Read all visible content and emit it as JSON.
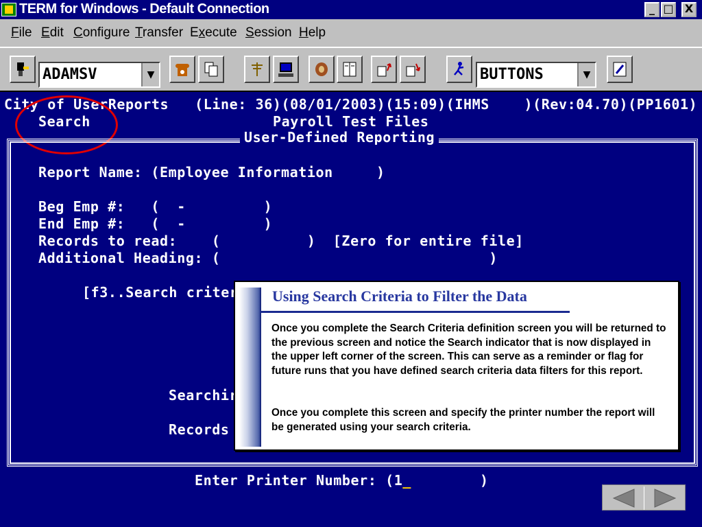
{
  "window": {
    "title": "TERM for Windows - Default Connection",
    "min_glyph": "_",
    "max_glyph": "□",
    "close_glyph": "X"
  },
  "menu": [
    {
      "key": "F",
      "rest": "ile"
    },
    {
      "key": "E",
      "rest": "dit"
    },
    {
      "key": "C",
      "rest": "onfigure"
    },
    {
      "key": "T",
      "rest": "ransfer"
    },
    {
      "pre": "E",
      "key": "x",
      "rest": "ecute"
    },
    {
      "key": "S",
      "rest": "ession"
    },
    {
      "key": "H",
      "rest": "elp"
    }
  ],
  "toolbar": {
    "connection_combo": "ADAMSV",
    "buttons_combo": "BUTTONS",
    "icons": [
      "dial-icon",
      "phone-icon",
      "copy-icon",
      "antenna-icon",
      "computer-icon",
      "glove-icon",
      "book-icon",
      "upload-icon",
      "download-icon",
      "runner-icon",
      "pen-icon"
    ]
  },
  "terminal": {
    "header_line": "City of UserReports   (Line: 36)(08/01/2003)(15:09)(IHMS    )(Rev:04.70)(PP1601)",
    "search_indicator": "Search",
    "subtitle": "Payroll Test Files",
    "screen_title": "User-Defined Reporting",
    "report_name_line": "Report Name: (Employee Information     )",
    "beg_emp_line": "Beg Emp #:   (  -         )",
    "end_emp_line": "End Emp #:   (  -         )",
    "records_line": "Records to read:    (          )  [Zero for entire file]",
    "heading_line": "Additional Heading: (                               )",
    "f3_line": "[f3..Search criter",
    "searching_line": "Searchir",
    "records_count_line": "Records",
    "printer_prompt": "Enter Printer Number: (1",
    "printer_cursor": "_",
    "printer_close": ")"
  },
  "callout": {
    "title": "Using Search Criteria to Filter the Data",
    "para1": "Once you complete the Search Criteria definition screen you will be returned to the previous screen and notice the Search indicator that is now displayed in the upper left corner of the screen.   This can serve as a reminder or flag for future runs that you have defined search criteria data filters for  this report.",
    "para2": "Once you complete this screen and specify the printer number the report will be generated using your search criteria."
  },
  "colors": {
    "terminal_bg": "#000080",
    "terminal_text": "#ffffff",
    "highlight_circle": "#e00000",
    "callout_title": "#2838a0"
  }
}
